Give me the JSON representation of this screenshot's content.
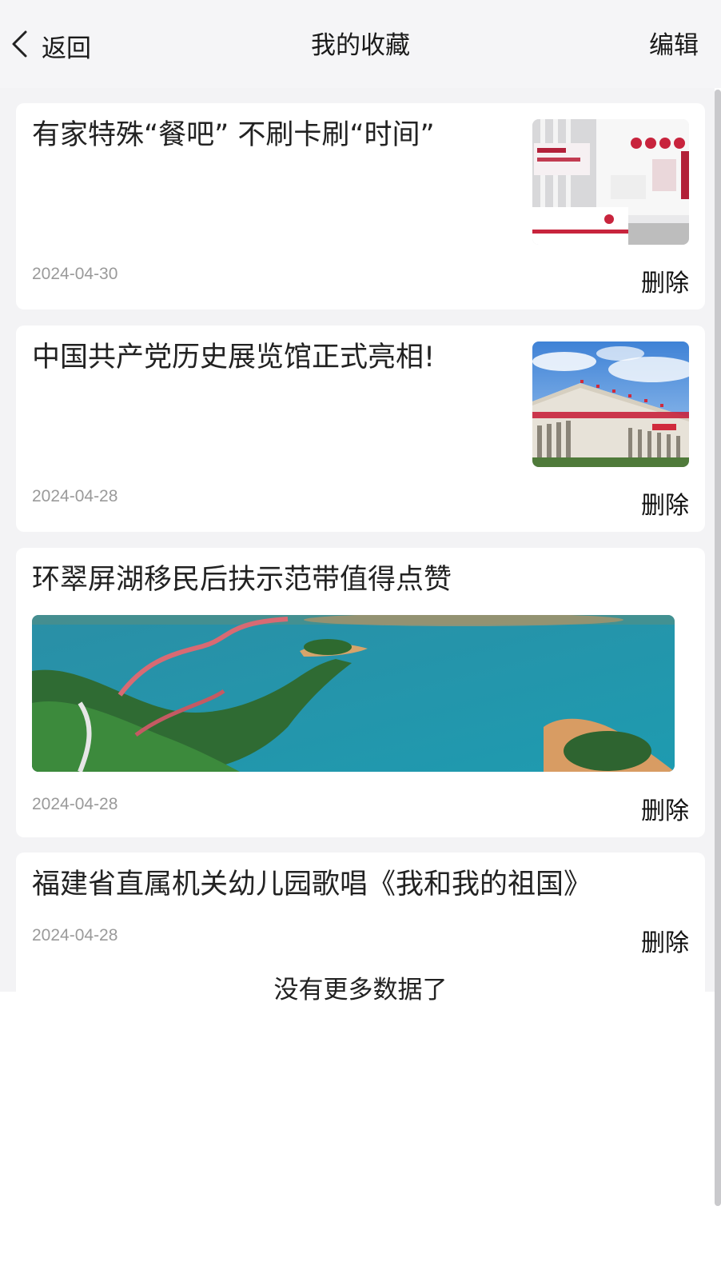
{
  "header": {
    "back_label": "返回",
    "title": "我的收藏",
    "edit_label": "编辑"
  },
  "items": [
    {
      "title": "有家特殊“餐吧” 不刷卡刷“时间”",
      "date": "2024-04-30",
      "delete_label": "删除",
      "image": "thumbnail-service-hall"
    },
    {
      "title": "中国共产党历史展览馆正式亮相!",
      "date": "2024-04-28",
      "delete_label": "删除",
      "image": "thumbnail-exhibition-hall"
    },
    {
      "title": "环翠屏湖移民后扶示范带值得点赞",
      "date": "2024-04-28",
      "delete_label": "删除",
      "image": "banner-lake-aerial"
    },
    {
      "title": "福建省直属机关幼儿园歌唱《我和我的祖国》",
      "date": "2024-04-28",
      "delete_label": "删除"
    }
  ],
  "footer": {
    "no_more_text": "没有更多数据了"
  },
  "colors": {
    "nav_background": "#f5f5f7",
    "list_background": "#f3f3f5",
    "card_background": "#ffffff",
    "date_text": "#9a9a9a"
  }
}
